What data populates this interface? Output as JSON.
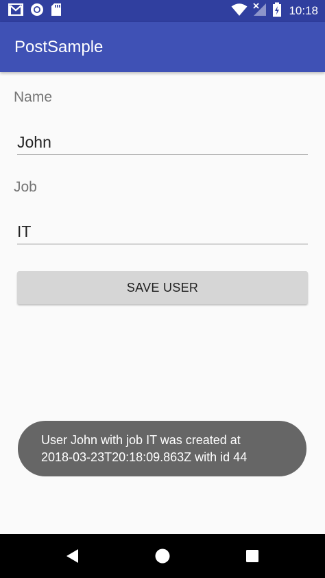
{
  "status_bar": {
    "time": "10:18",
    "icons": [
      "gmail-icon",
      "circle-app-icon",
      "sd-card-icon",
      "wifi-icon",
      "signal-no-data-icon",
      "battery-charging-icon"
    ]
  },
  "app_bar": {
    "title": "PostSample",
    "color": "#3f51b5",
    "status_color": "#303f9f"
  },
  "form": {
    "name_label": "Name",
    "name_value": "John",
    "job_label": "Job",
    "job_value": "IT",
    "save_button_label": "SAVE USER"
  },
  "toast": {
    "line1": "User John with job IT was created at",
    "line2": "2018-03-23T20:18:09.863Z with id 44"
  },
  "nav_bar": {
    "icons": [
      "back-icon",
      "home-icon",
      "recents-icon"
    ]
  }
}
